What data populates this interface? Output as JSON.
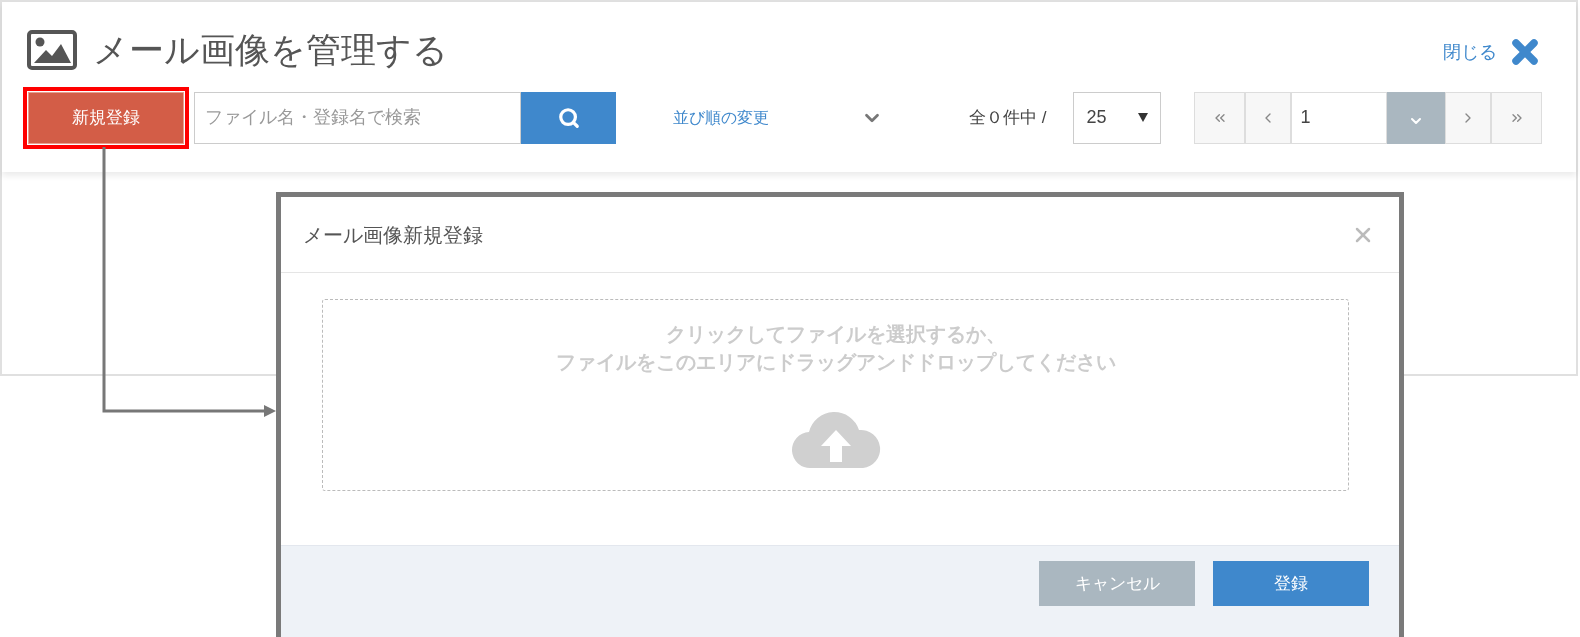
{
  "header": {
    "title": "メール画像を管理する",
    "close_label": "閉じる"
  },
  "toolbar": {
    "new_button": "新規登録",
    "search": {
      "placeholder": "ファイル名・登録名で検索"
    },
    "sort_link": "並び順の変更",
    "count": "全０件中 /",
    "per_page": "25",
    "page": "1"
  },
  "dialog": {
    "title": "メール画像新規登録",
    "dropzone_lines": [
      "クリックしてファイルを選択するか、",
      "ファイルをこのエリアにドラッグアンドドロップしてください"
    ],
    "buttons": [
      {
        "label": "キャンセル",
        "kind": "secondary"
      },
      {
        "label": "登録",
        "kind": "primary"
      }
    ]
  }
}
